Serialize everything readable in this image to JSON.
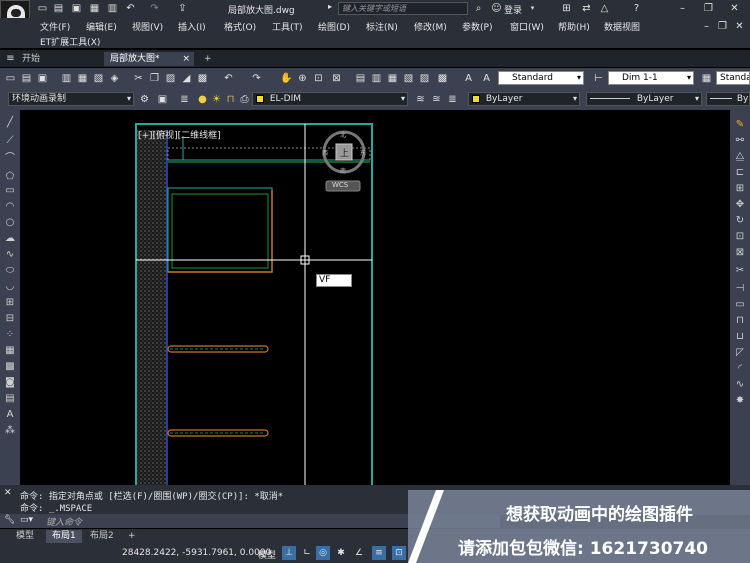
{
  "titlebar": {
    "filename": "局部放大图.dwg",
    "search_placeholder": "键入关键字或短语",
    "login_label": "登录"
  },
  "menu": {
    "items": [
      "文件(F)",
      "编辑(E)",
      "视图(V)",
      "插入(I)",
      "格式(O)",
      "工具(T)",
      "绘图(D)",
      "标注(N)",
      "修改(M)",
      "参数(P)",
      "窗口(W)",
      "帮助(H)",
      "数据视图"
    ],
    "row2": [
      "ET扩展工具(X)"
    ]
  },
  "tabs": {
    "start": "开始",
    "drawing": "局部放大图*",
    "add": "+"
  },
  "toolbar1": {
    "text_style": "Standard",
    "dim_style": "Dim 1-1",
    "table_style": "Standa"
  },
  "toolbar2": {
    "workspace": "环境动画录制",
    "layer": "EL-DIM",
    "color": "ByLayer",
    "linetype": "ByLayer",
    "lineweight": "By"
  },
  "canvas": {
    "viewport_label": "[+][俯视][二维线框]",
    "wcs_label": "WCS",
    "viewcube_face": "上",
    "dynamic_input": "VF",
    "compass": {
      "n": "北",
      "s": "南",
      "e": "东",
      "w": "西"
    }
  },
  "command": {
    "line1": "命令: 指定对角点或 [栏选(F)/圈围(WP)/圈交(CP)]: *取消*",
    "line2": "命令: _.MSPACE",
    "input_placeholder": "键入命令"
  },
  "layout_tabs": [
    "模型",
    "布局1",
    "布局2"
  ],
  "status": {
    "coords": "28428.2422, -5931.7961, 0.0000",
    "model_label": "模型"
  },
  "promo": {
    "line1": "想获取动画中的绘图插件",
    "line2": "请添加包包微信: 1621730740"
  },
  "colors": {
    "ui_dark": "#2b2f38",
    "ui_mid": "#3b4150",
    "canvas_bg": "#000000",
    "cyan_line": "#2aa89a",
    "orange_line": "#c8782a",
    "blue_line": "#3050c8"
  }
}
